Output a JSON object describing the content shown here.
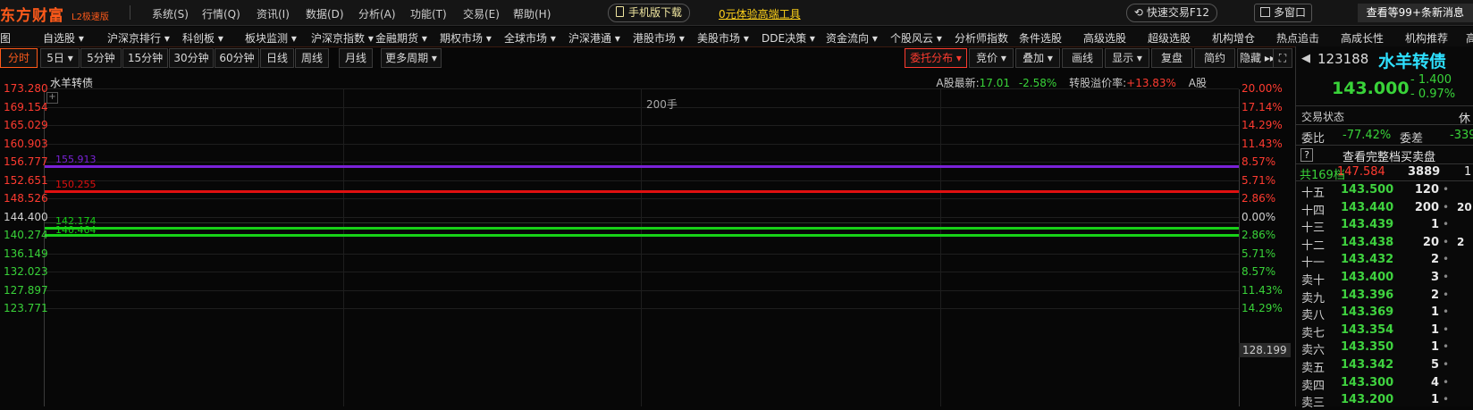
{
  "app": {
    "logo": "东方财富",
    "edition": "L2极速版"
  },
  "menu": [
    "系统(S)",
    "行情(Q)",
    "资讯(I)",
    "数据(D)",
    "分析(A)",
    "功能(T)",
    "交易(E)",
    "帮助(H)"
  ],
  "promo": {
    "mobile_download": "手机版下载",
    "free_trial": "0元体验高端工具"
  },
  "top_right": {
    "fast_trade": "快速交易F12",
    "multi_window": "多窗口",
    "messages": "查看等99+条新消息"
  },
  "nav": [
    "图",
    "自选股",
    "沪深京排行",
    "科创板",
    "板块监测",
    "沪深京指数",
    "金融期货",
    "期权市场",
    "全球市场",
    "沪深港通",
    "港股市场",
    "美股市场",
    "DDE决策",
    "资金流向",
    "个股风云",
    "分析师指数",
    "条件选股",
    "高级选股",
    "超级选股",
    "机构增仓",
    "热点追击",
    "高成长性",
    "机构推荐",
    "高"
  ],
  "periods": [
    "分时",
    "5日",
    "5分钟",
    "15分钟",
    "30分钟",
    "60分钟",
    "日线",
    "周线",
    "月线",
    "更多周期"
  ],
  "tools": [
    "委托分布",
    "竞价",
    "叠加",
    "画线",
    "显示",
    "复盘",
    "简约",
    "隐藏"
  ],
  "chart": {
    "title": "水羊转债",
    "a_share_label": "A股最新:",
    "a_share_price": "17.01",
    "a_share_change": "-2.58%",
    "premium_label": "转股溢价率:",
    "premium_value": "+13.83%",
    "a_share_tag": "A股",
    "volume_label": "200手",
    "cursor_price": "128.199",
    "colors": {
      "up": "#ff3b30",
      "down": "#39d339",
      "level_purple": "#7a22d8",
      "level_red": "#e01010",
      "level_green": "#17d117"
    }
  },
  "chart_data": {
    "type": "line",
    "y_left_ticks": [
      "173.280",
      "169.154",
      "165.029",
      "160.903",
      "156.777",
      "152.651",
      "148.526",
      "144.400",
      "140.274",
      "136.149",
      "132.023",
      "127.897",
      "123.771"
    ],
    "y_right_ticks": [
      "20.00%",
      "17.14%",
      "14.29%",
      "11.43%",
      "8.57%",
      "5.71%",
      "2.86%",
      "0.00%",
      "2.86%",
      "5.71%",
      "8.57%",
      "11.43%",
      "14.29%"
    ],
    "levels": [
      {
        "label": "155.913",
        "value": 155.913,
        "color": "purple"
      },
      {
        "label": "150.255",
        "value": 150.255,
        "color": "red"
      },
      {
        "label": "142.174",
        "value": 142.174,
        "color": "green"
      },
      {
        "label": "140.464",
        "value": 140.464,
        "color": "green"
      }
    ],
    "ylim": [
      123.771,
      173.28
    ]
  },
  "quote": {
    "code": "123188",
    "name": "水羊转债",
    "price": "143.000",
    "change": "- 1.400",
    "change_pct": "- 0.97%",
    "status_label": "交易状态",
    "status_value": "休",
    "wei_bi_label": "委比",
    "wei_bi_value": "-77.42%",
    "wei_cha_label": "委差",
    "wei_cha_value": "-339",
    "full_book_link": "查看完整档买卖盘",
    "help": "?",
    "total_levels_label": "共169档",
    "total_price": "147.584",
    "total_vol": "3889",
    "total_extra": "1"
  },
  "order_book": [
    {
      "name": "十五",
      "price": "143.500",
      "vol": "120",
      "extra": ""
    },
    {
      "name": "十四",
      "price": "143.440",
      "vol": "200",
      "extra": "20"
    },
    {
      "name": "十三",
      "price": "143.439",
      "vol": "1",
      "extra": ""
    },
    {
      "name": "十二",
      "price": "143.438",
      "vol": "20",
      "extra": "2"
    },
    {
      "name": "十一",
      "price": "143.432",
      "vol": "2",
      "extra": ""
    },
    {
      "name": "卖十",
      "price": "143.400",
      "vol": "3",
      "extra": ""
    },
    {
      "name": "卖九",
      "price": "143.396",
      "vol": "2",
      "extra": ""
    },
    {
      "name": "卖八",
      "price": "143.369",
      "vol": "1",
      "extra": ""
    },
    {
      "name": "卖七",
      "price": "143.354",
      "vol": "1",
      "extra": ""
    },
    {
      "name": "卖六",
      "price": "143.350",
      "vol": "1",
      "extra": ""
    },
    {
      "name": "卖五",
      "price": "143.342",
      "vol": "5",
      "extra": ""
    },
    {
      "name": "卖四",
      "price": "143.300",
      "vol": "4",
      "extra": ""
    },
    {
      "name": "卖三",
      "price": "143.200",
      "vol": "1",
      "extra": ""
    }
  ]
}
